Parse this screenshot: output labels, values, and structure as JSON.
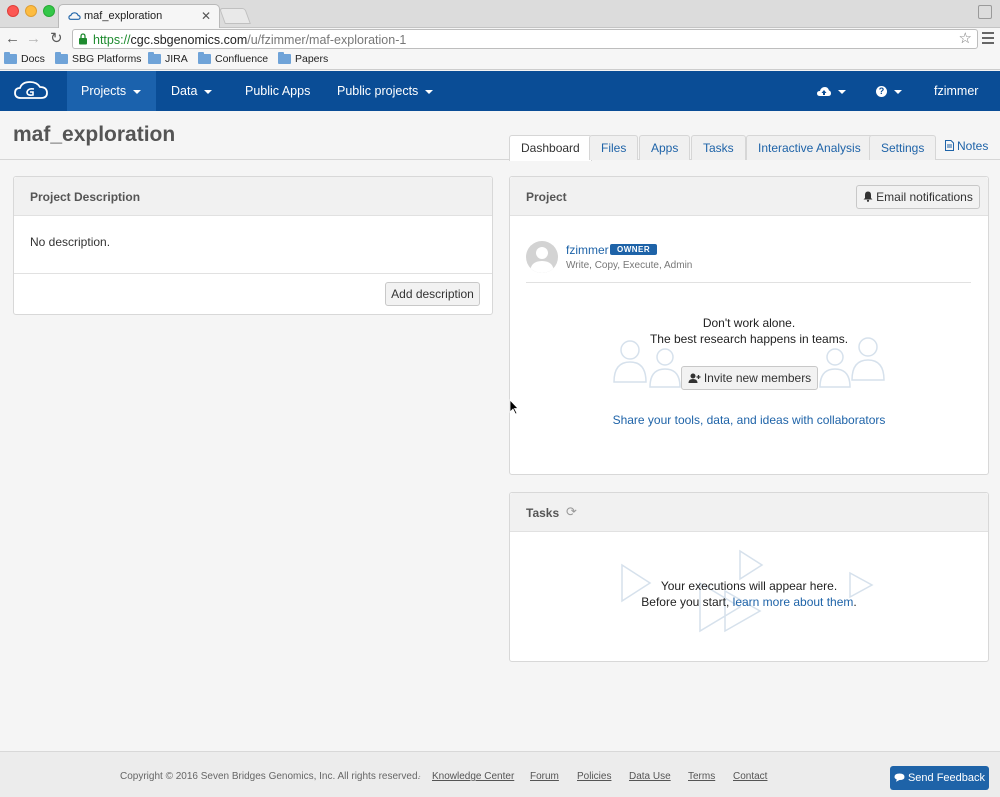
{
  "browser": {
    "tab_title": "maf_exploration",
    "url_https": "https://",
    "url_host": "cgc.sbgenomics.com",
    "url_path": "/u/fzimmer/maf-exploration-1",
    "bookmarks": [
      "Docs",
      "SBG Platforms",
      "JIRA",
      "Confluence",
      "Papers"
    ]
  },
  "nav": {
    "items": [
      "Projects",
      "Data",
      "Public Apps",
      "Public projects"
    ],
    "user": "fzimmer",
    "brand_color": "#0a4d96"
  },
  "page": {
    "title": "maf_exploration",
    "tabs": [
      "Dashboard",
      "Files",
      "Apps",
      "Tasks",
      "Interactive Analysis",
      "Settings"
    ],
    "notes": "Notes"
  },
  "description_panel": {
    "title": "Project Description",
    "text": "No description.",
    "button": "Add description"
  },
  "project_panel": {
    "title": "Project",
    "email_button": "Email notifications",
    "member": {
      "name": "fzimmer",
      "badge": "OWNER",
      "permissions": "Write, Copy, Execute, Admin"
    },
    "empty_line1": "Don't work alone.",
    "empty_line2": "The best research happens in teams.",
    "invite_button": "Invite new members",
    "collab_link": "Share your tools, data, and ideas with collaborators"
  },
  "tasks_panel": {
    "title": "Tasks",
    "line1": "Your executions will appear here.",
    "line2_prefix": "Before you start, ",
    "line2_link": "learn more about them",
    "line2_suffix": "."
  },
  "footer": {
    "copyright": "Copyright © 2016 Seven Bridges Genomics, Inc. All rights reserved.",
    "links": [
      "Knowledge Center",
      "Forum",
      "Policies",
      "Data Use",
      "Terms",
      "Contact"
    ],
    "feedback_button": "Send Feedback"
  }
}
